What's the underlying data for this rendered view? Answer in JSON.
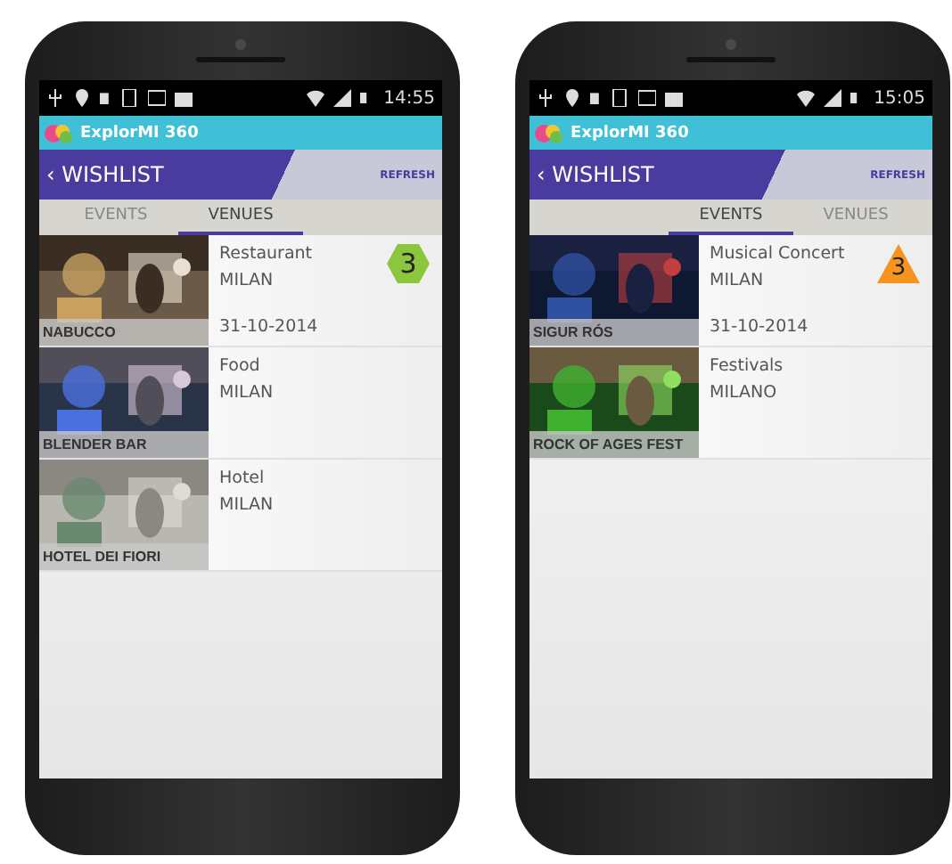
{
  "phones": [
    {
      "status_time": "14:55",
      "app_title": "ExplorMI 360",
      "back_label": "WISHLIST",
      "refresh_label": "REFRESH",
      "back_glyph": "‹",
      "tabs": [
        {
          "label": "EVENTS",
          "selected": false
        },
        {
          "label": "VENUES",
          "selected": true
        }
      ],
      "items": [
        {
          "caption": "NABUCCO",
          "category": "Restaurant",
          "city": "MILAN",
          "date": "31-10-2014",
          "badge": {
            "text": "3",
            "kind": "hexagon",
            "color": "#8cc63f"
          }
        },
        {
          "caption": "BLENDER BAR",
          "category": "Food",
          "city": "MILAN"
        },
        {
          "caption": "HOTEL DEI FIORI",
          "category": "Hotel",
          "city": "MILAN"
        }
      ]
    },
    {
      "status_time": "15:05",
      "app_title": "ExplorMI 360",
      "back_label": "WISHLIST",
      "refresh_label": "REFRESH",
      "back_glyph": "‹",
      "tabs": [
        {
          "label": "EVENTS",
          "selected": true
        },
        {
          "label": "VENUES",
          "selected": false
        }
      ],
      "items": [
        {
          "caption": "SIGUR RÓS",
          "category": "Musical Concert",
          "city": "MILAN",
          "date": "31-10-2014",
          "badge": {
            "text": "3",
            "kind": "triangle",
            "color": "#f7941d"
          }
        },
        {
          "caption": "ROCK OF AGES FEST",
          "category": "Festivals",
          "city": "MILANO"
        }
      ]
    }
  ]
}
